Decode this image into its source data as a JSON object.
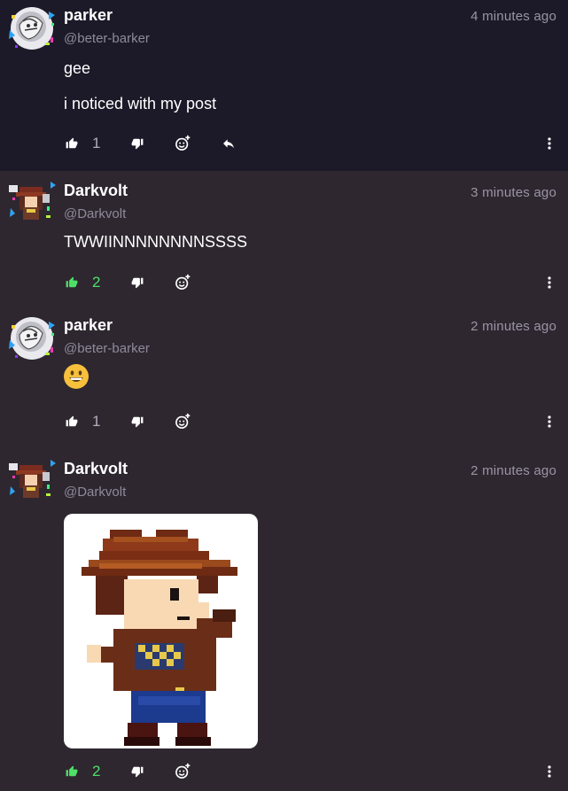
{
  "posts": [
    {
      "name": "parker",
      "handle": "@beter-barker",
      "time": "4 minutes ago",
      "lines": [
        "gee",
        "i noticed with my post"
      ],
      "likes": "1",
      "liked": false,
      "has_reply": true
    },
    {
      "name": "Darkvolt",
      "handle": "@Darkvolt",
      "time": "3 minutes ago",
      "lines": [
        "TWWIINNNNNNNNSSSS"
      ],
      "likes": "2",
      "liked": true
    },
    {
      "name": "parker",
      "handle": "@beter-barker",
      "time": "2 minutes ago",
      "emoji": "grinning-face",
      "likes": "1",
      "liked": false
    },
    {
      "name": "Darkvolt",
      "handle": "@Darkvolt",
      "time": "2 minutes ago",
      "image": "pixel-cowboy-sprite",
      "likes": "2",
      "liked": true
    }
  ],
  "icons": {
    "like": "thumbs-up-icon",
    "dislike": "thumbs-down-icon",
    "react": "add-reaction-icon",
    "reply": "reply-icon",
    "more": "more-vertical-icon"
  },
  "colors": {
    "liked": "#4ee066",
    "highlight_bg": "#1c1a28",
    "page_bg": "#2e2730"
  }
}
